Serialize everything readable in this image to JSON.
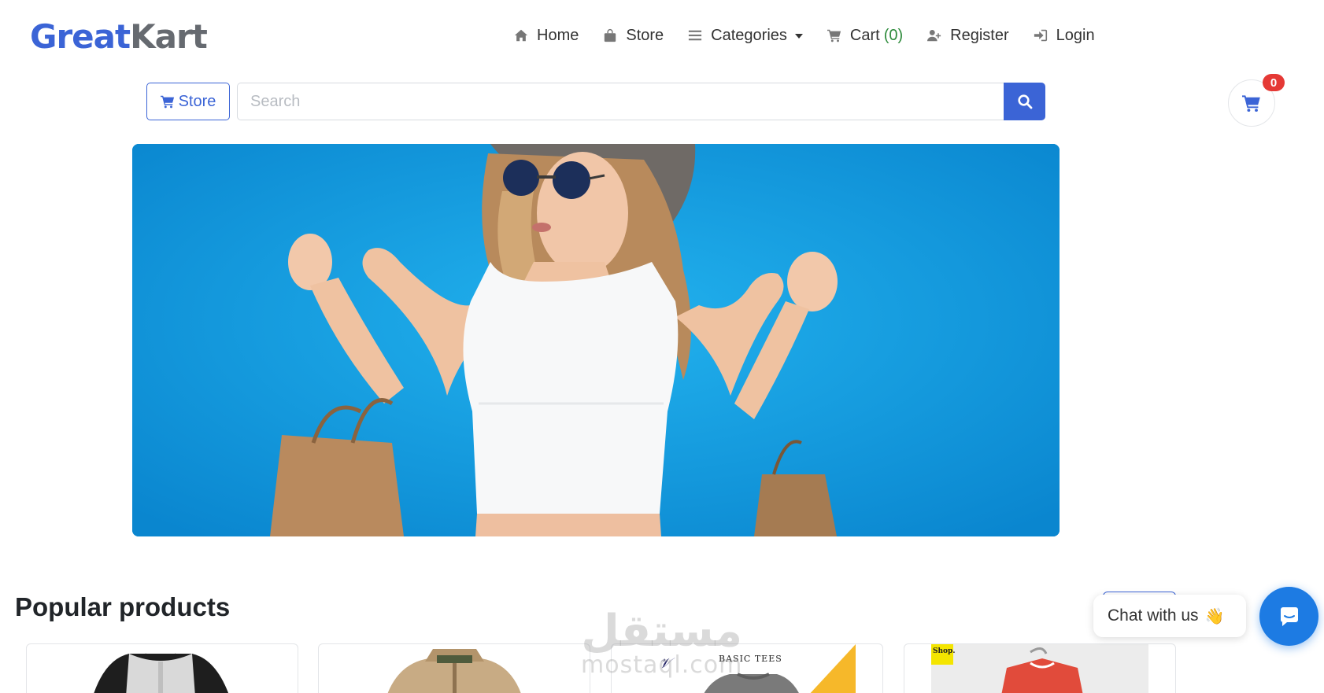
{
  "header": {
    "logo_part1": "Great",
    "logo_part2": "Kart",
    "nav": {
      "home": "Home",
      "store": "Store",
      "categories": "Categories",
      "cart": "Cart",
      "cart_count": "(0)",
      "register": "Register",
      "login": "Login"
    }
  },
  "search": {
    "store_button": "Store",
    "placeholder": "Search",
    "value": ""
  },
  "cart_widget": {
    "badge": "0"
  },
  "banner": {
    "icon": "shopping-woman-photo"
  },
  "popular": {
    "title": "Popular products",
    "cards": [
      {
        "image": "raglan-henley-shirt"
      },
      {
        "image": "khaki-jacket"
      },
      {
        "image": "basic-tees",
        "brand_text": "BASIC TEES"
      },
      {
        "image": "red-shirt-on-hanger",
        "brand_text": "Shop."
      }
    ]
  },
  "watermark": {
    "arabic": "مستقل",
    "latin": "mostaql.com"
  },
  "chat": {
    "label": "Chat with us",
    "emoji": "👋"
  },
  "colors": {
    "brand_blue": "#3b64d6",
    "logo_grey": "#666a70",
    "cart_count_green": "#2e8b3c",
    "badge_red": "#e53935",
    "banner_blue": "#0b96dd",
    "chat_blue": "#1d7be3"
  }
}
